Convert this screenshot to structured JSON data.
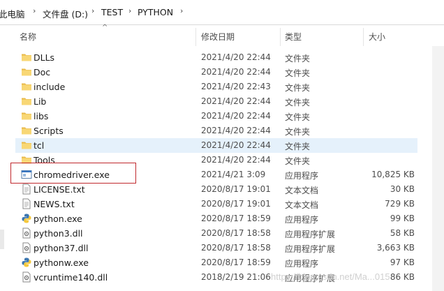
{
  "breadcrumb": {
    "items": [
      "此电脑",
      "文件盘 (D:)",
      "TEST",
      "PYTHON"
    ]
  },
  "columns": {
    "name": "名称",
    "modified": "修改日期",
    "type": "类型",
    "size": "大小"
  },
  "files": [
    {
      "name": "DLLs",
      "date": "2021/4/20 22:44",
      "type": "文件夹",
      "size": "",
      "icon": "folder-icon"
    },
    {
      "name": "Doc",
      "date": "2021/4/20 22:44",
      "type": "文件夹",
      "size": "",
      "icon": "folder-icon"
    },
    {
      "name": "include",
      "date": "2021/4/20 22:43",
      "type": "文件夹",
      "size": "",
      "icon": "folder-icon"
    },
    {
      "name": "Lib",
      "date": "2021/4/20 22:44",
      "type": "文件夹",
      "size": "",
      "icon": "folder-icon"
    },
    {
      "name": "libs",
      "date": "2021/4/20 22:44",
      "type": "文件夹",
      "size": "",
      "icon": "folder-icon"
    },
    {
      "name": "Scripts",
      "date": "2021/4/20 22:44",
      "type": "文件夹",
      "size": "",
      "icon": "folder-icon"
    },
    {
      "name": "tcl",
      "date": "2021/4/20 22:44",
      "type": "文件夹",
      "size": "",
      "icon": "folder-icon"
    },
    {
      "name": "Tools",
      "date": "2021/4/20 22:44",
      "type": "文件夹",
      "size": "",
      "icon": "folder-icon"
    },
    {
      "name": "chromedriver.exe",
      "date": "2021/4/21 3:09",
      "type": "应用程序",
      "size": "10,825 KB",
      "icon": "exe-icon"
    },
    {
      "name": "LICENSE.txt",
      "date": "2020/8/17 19:01",
      "type": "文本文档",
      "size": "30 KB",
      "icon": "text-file-icon"
    },
    {
      "name": "NEWS.txt",
      "date": "2020/8/17 19:01",
      "type": "文本文档",
      "size": "729 KB",
      "icon": "text-file-icon"
    },
    {
      "name": "python.exe",
      "date": "2020/8/17 18:59",
      "type": "应用程序",
      "size": "99 KB",
      "icon": "python-icon"
    },
    {
      "name": "python3.dll",
      "date": "2020/8/17 18:58",
      "type": "应用程序扩展",
      "size": "58 KB",
      "icon": "dll-icon"
    },
    {
      "name": "python37.dll",
      "date": "2020/8/17 18:58",
      "type": "应用程序扩展",
      "size": "3,663 KB",
      "icon": "dll-icon"
    },
    {
      "name": "pythonw.exe",
      "date": "2020/8/17 18:59",
      "type": "应用程序",
      "size": "97 KB",
      "icon": "python-icon"
    },
    {
      "name": "vcruntime140.dll",
      "date": "2018/2/19 21:06",
      "type": "应用程序扩展",
      "size": "86 KB",
      "icon": "dll-icon"
    }
  ],
  "watermark": "https://blog.csdn.net/Ma...015",
  "colors": {
    "folder": "#f8d775",
    "selected": "#e5f1fb",
    "highlight_border": "#c0282d"
  }
}
